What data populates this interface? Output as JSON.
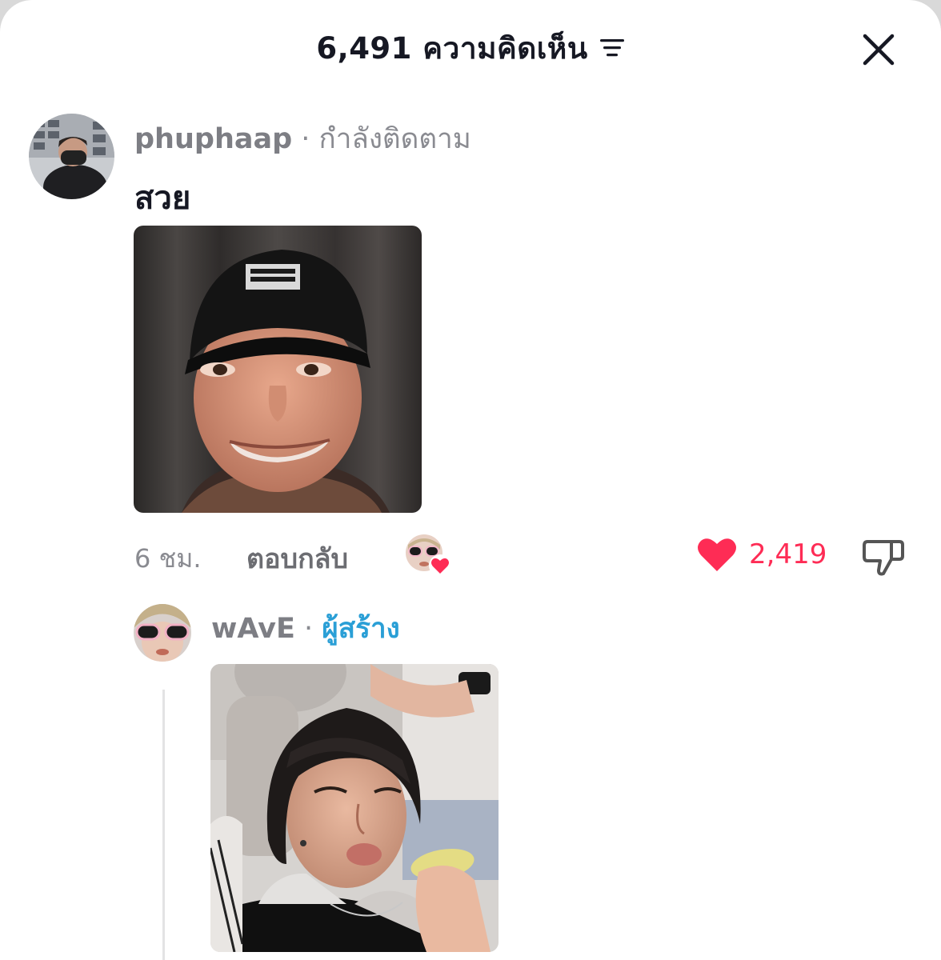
{
  "header": {
    "title": "6,491 ความคิดเห็น",
    "sort_icon": "sort-lines-icon",
    "close_icon": "close-icon"
  },
  "comments": [
    {
      "username": "phuphaap",
      "separator": " · ",
      "status": "กำลังติดตาม",
      "text": "สวย",
      "image": "photo of person in black cap with face filter",
      "time": "6 ชม.",
      "reply_label": "ตอบกลับ",
      "creator_liked": true,
      "likes": "2,419"
    }
  ],
  "replies": [
    {
      "username": "wAvE",
      "separator": " · ",
      "badge": "ผู้สร้าง",
      "image": "photo of person with dark hair making a pout face"
    }
  ],
  "colors": {
    "like": "#fe2c55",
    "creator_badge": "#2a9fd6",
    "muted_text": "#8a8b91"
  }
}
